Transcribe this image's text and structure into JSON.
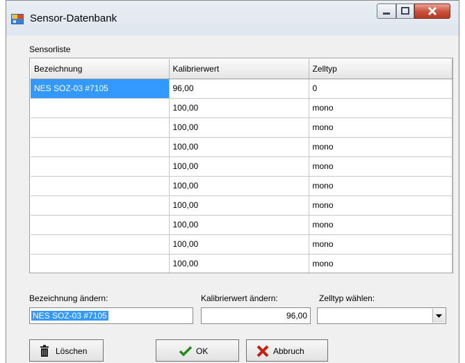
{
  "window": {
    "title": "Sensor-Datenbank",
    "title_icon": "sensor-database-icon"
  },
  "group_label": "Sensorliste",
  "grid": {
    "columns": [
      "Bezeichnung",
      "Kalibrierwert",
      "Zelltyp"
    ],
    "rows": [
      {
        "bezeichnung": "NES SOZ-03 #7105",
        "kalibrierwert": "96,00",
        "zelltyp": "0",
        "selected": true
      },
      {
        "bezeichnung": "",
        "kalibrierwert": "100,00",
        "zelltyp": "mono"
      },
      {
        "bezeichnung": "",
        "kalibrierwert": "100,00",
        "zelltyp": "mono"
      },
      {
        "bezeichnung": "",
        "kalibrierwert": "100,00",
        "zelltyp": "mono"
      },
      {
        "bezeichnung": "",
        "kalibrierwert": "100,00",
        "zelltyp": "mono"
      },
      {
        "bezeichnung": "",
        "kalibrierwert": "100,00",
        "zelltyp": "mono"
      },
      {
        "bezeichnung": "",
        "kalibrierwert": "100,00",
        "zelltyp": "mono"
      },
      {
        "bezeichnung": "",
        "kalibrierwert": "100,00",
        "zelltyp": "mono"
      },
      {
        "bezeichnung": "",
        "kalibrierwert": "100,00",
        "zelltyp": "mono"
      },
      {
        "bezeichnung": "",
        "kalibrierwert": "100,00",
        "zelltyp": "mono"
      }
    ]
  },
  "edit": {
    "name_label": "Bezeichnung ändern:",
    "name_value": "NES SOZ-03 #7105",
    "calib_label": "Kalibrierwert ändern:",
    "calib_value": "96,00",
    "celltype_label": "Zelltyp wählen:",
    "celltype_value": ""
  },
  "buttons": {
    "delete": "Löschen",
    "ok": "OK",
    "cancel": "Abbruch"
  },
  "colors": {
    "selection": "#3399ff",
    "ok_check": "#1f8a16",
    "cancel_x": "#c81e12"
  }
}
